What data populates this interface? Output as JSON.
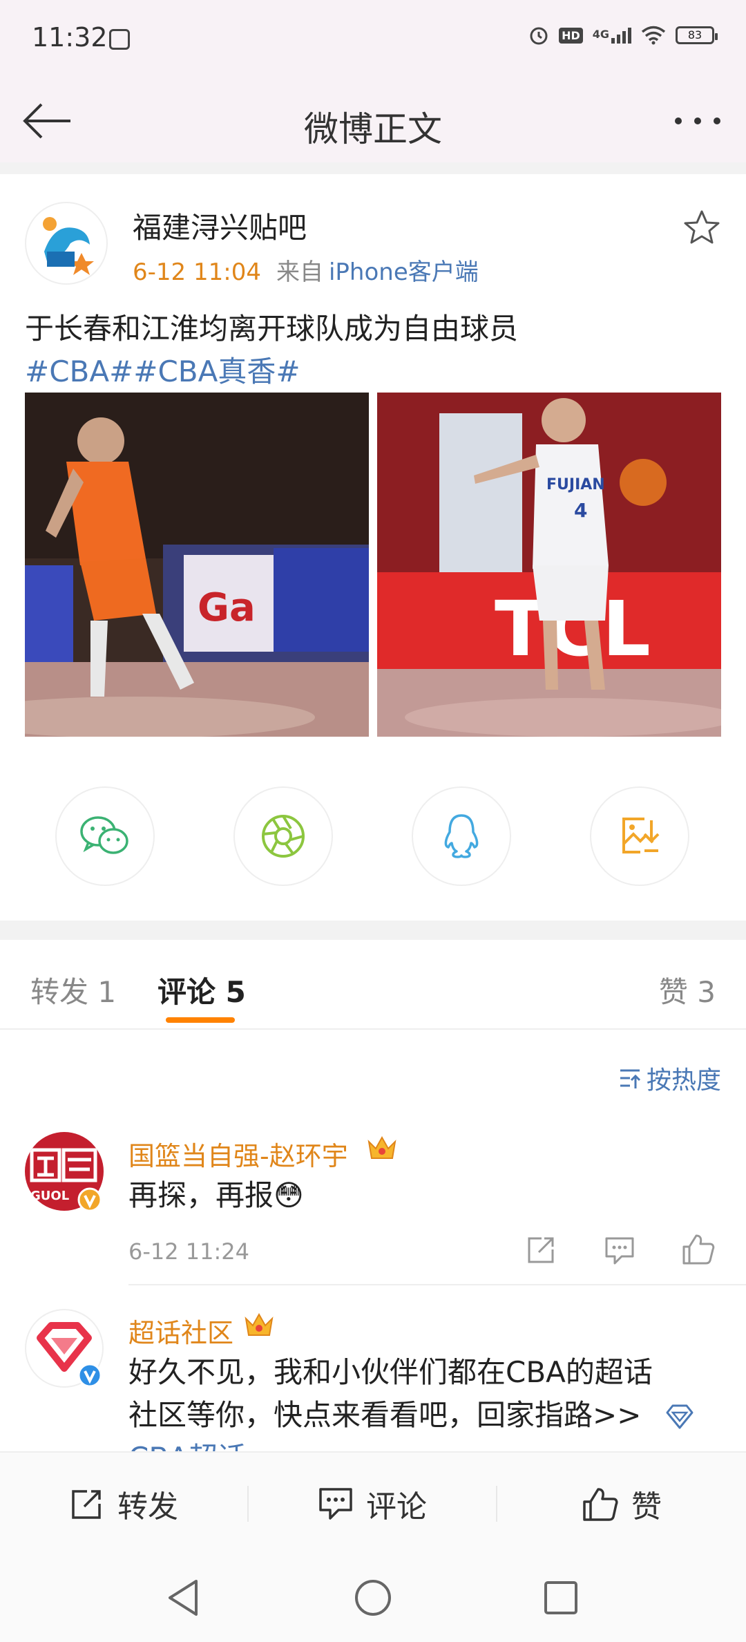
{
  "status_bar": {
    "time": "11:32",
    "network": "4G",
    "hd": "HD",
    "battery": "83"
  },
  "header": {
    "title": "微博正文"
  },
  "post": {
    "author": "福建浔兴贴吧",
    "date": "6-12 11:04",
    "from_label": "来自",
    "device": "iPhone客户端",
    "text": "于长春和江淮均离开球队成为自由球员",
    "tags": "#CBA##CBA真香#"
  },
  "share_icons": [
    "wechat-icon",
    "moments-icon",
    "qq-icon",
    "save-image-icon"
  ],
  "tabs": {
    "repost": "转发 1",
    "comment": "评论 5",
    "like": "赞 3"
  },
  "sort": {
    "label": "按热度"
  },
  "comments": [
    {
      "name": "国篮当自强-赵环宇",
      "text": "再探，再报😳",
      "time": "6-12 11:24"
    },
    {
      "name": "超话社区",
      "text_line1": "好久不见，我和小伙伴们都在CBA的超话",
      "text_line2": "社区等你，快点来看看吧，回家指路>>",
      "text_line3": "CBA超话"
    }
  ],
  "action_bar": {
    "repost": "转发",
    "comment": "评论",
    "like": "赞"
  },
  "colors": {
    "accent_orange": "#ff8200",
    "link_blue": "#4a78b5",
    "name_orange": "#e0861a"
  }
}
